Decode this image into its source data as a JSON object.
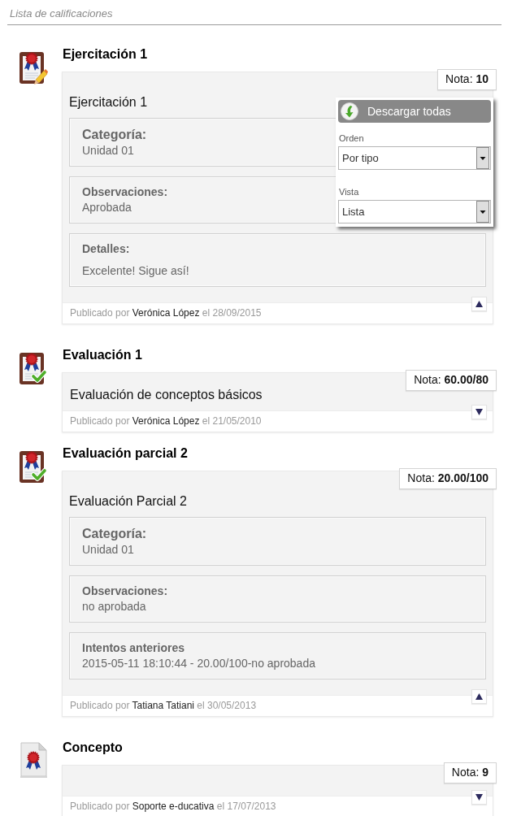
{
  "header": {
    "title": "Lista de calificaciones"
  },
  "entries": [
    {
      "kind": "exercise",
      "title": "Ejercitación 1",
      "grade": "Nota: **10**",
      "subtitle": "Ejercitación 1",
      "expanded": true,
      "fields": [
        {
          "kind": "category",
          "label": "Categoría:",
          "value": "Unidad 01"
        },
        {
          "kind": "field",
          "label": "Observaciones:",
          "value": "Aprobada"
        },
        {
          "kind": "note",
          "label": "Detalles:",
          "value": "Excelente! Sigue así!"
        }
      ],
      "footer": {
        "prefix": "Publicado por",
        "author": "Verónica López",
        "suffix": "el 28/09/2015"
      }
    },
    {
      "kind": "evaluation",
      "title": "Evaluación 1",
      "grade": "Nota: **60.00/80**",
      "subtitle": "Evaluación de conceptos básicos",
      "expanded": false,
      "footer": {
        "prefix": "Publicado por",
        "author": "Verónica López",
        "suffix": "el 21/05/2010"
      }
    },
    {
      "kind": "evaluation",
      "title": "Evaluación parcial 2",
      "grade": "Nota: **20.00/100**",
      "subtitle": "Evaluación Parcial 2",
      "expanded": true,
      "fields": [
        {
          "kind": "category",
          "label": "Categoría:",
          "value": "Unidad 01"
        },
        {
          "kind": "field",
          "label": "Observaciones:",
          "value": "no aprobada"
        },
        {
          "kind": "field",
          "label": "Intentos anteriores",
          "value": "2015-05-11 18:10:44 - 20.00/100-no aprobada"
        }
      ],
      "footer": {
        "prefix": "Publicado por",
        "author": "Tatiana Tatiani",
        "suffix": "el 30/05/2013"
      }
    },
    {
      "kind": "concept",
      "title": "Concepto",
      "grade": "Nota: **9**",
      "expanded": false,
      "footer": {
        "prefix": "Publicado por",
        "author": "Soporte e-ducativa",
        "suffix": "el 17/07/2013"
      }
    }
  ],
  "popup": {
    "download_button": "Descargar todas",
    "selects": [
      {
        "label": "Orden",
        "value": "Por tipo"
      },
      {
        "label": "Vista",
        "value": "Lista"
      }
    ]
  }
}
